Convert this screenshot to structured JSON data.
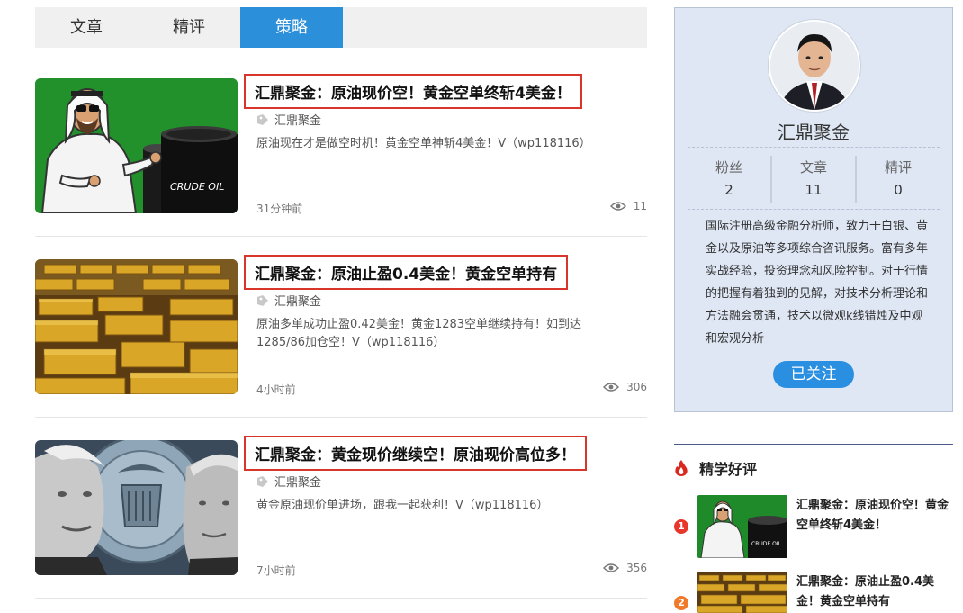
{
  "tabs": [
    {
      "label": "文章",
      "active": false
    },
    {
      "label": "精评",
      "active": false
    },
    {
      "label": "策略",
      "active": true
    }
  ],
  "articles": [
    {
      "title": "汇鼎聚金：原油现价空！黄金空单终斩4美金！",
      "author": "汇鼎聚金",
      "summary": "原油现在才是做空时机！黄金空单神斩4美金！V（wp118116）",
      "time": "31分钟前",
      "views": "11",
      "thumb_icon": "crude-oil-barrels-image",
      "thumb_text": "CRUDE OIL"
    },
    {
      "title": "汇鼎聚金：原油止盈0.4美金！黄金空单持有",
      "author": "汇鼎聚金",
      "summary": "原油多单成功止盈0.42美金！黄金1283空单继续持有！如到达1285/86加仓空！V（wp118116）",
      "time": "4小时前",
      "views": "306",
      "thumb_icon": "gold-bars-image"
    },
    {
      "title": "汇鼎聚金：黄金现价继续空！原油现价高位多！",
      "author": "汇鼎聚金",
      "summary": "黄金原油现价单进场，跟我一起获利！V（wp118116）",
      "time": "7小时前",
      "views": "356",
      "thumb_icon": "federal-reserve-image"
    }
  ],
  "profile": {
    "name": "汇鼎聚金",
    "stats": [
      {
        "label": "粉丝",
        "value": "2"
      },
      {
        "label": "文章",
        "value": "11"
      },
      {
        "label": "精评",
        "value": "0"
      }
    ],
    "bio": "国际注册高级金融分析师，致力于白银、黄金以及原油等多项综合咨讯服务。富有多年实战经验，投资理念和风险控制。对于行情的把握有着独到的见解，对技术分析理论和方法融会贯通，技术以微观k线错烛及中观和宏观分析",
    "follow_label": "已关注"
  },
  "side": {
    "heading": "精学好评",
    "items": [
      {
        "rank": "1",
        "title": "汇鼎聚金：原油现价空！黄金空单终斩4美金！",
        "rank_color": "#e8362c",
        "thumb_text": "CRUDE OIL"
      },
      {
        "rank": "2",
        "title": "汇鼎聚金：原油止盈0.4美金！黄金空单持有",
        "rank_color": "#f07a2a"
      }
    ]
  },
  "colors": {
    "accent": "#2c8fd9",
    "highlight_border": "#d9362b",
    "profile_bg": "#dfe7f5"
  }
}
